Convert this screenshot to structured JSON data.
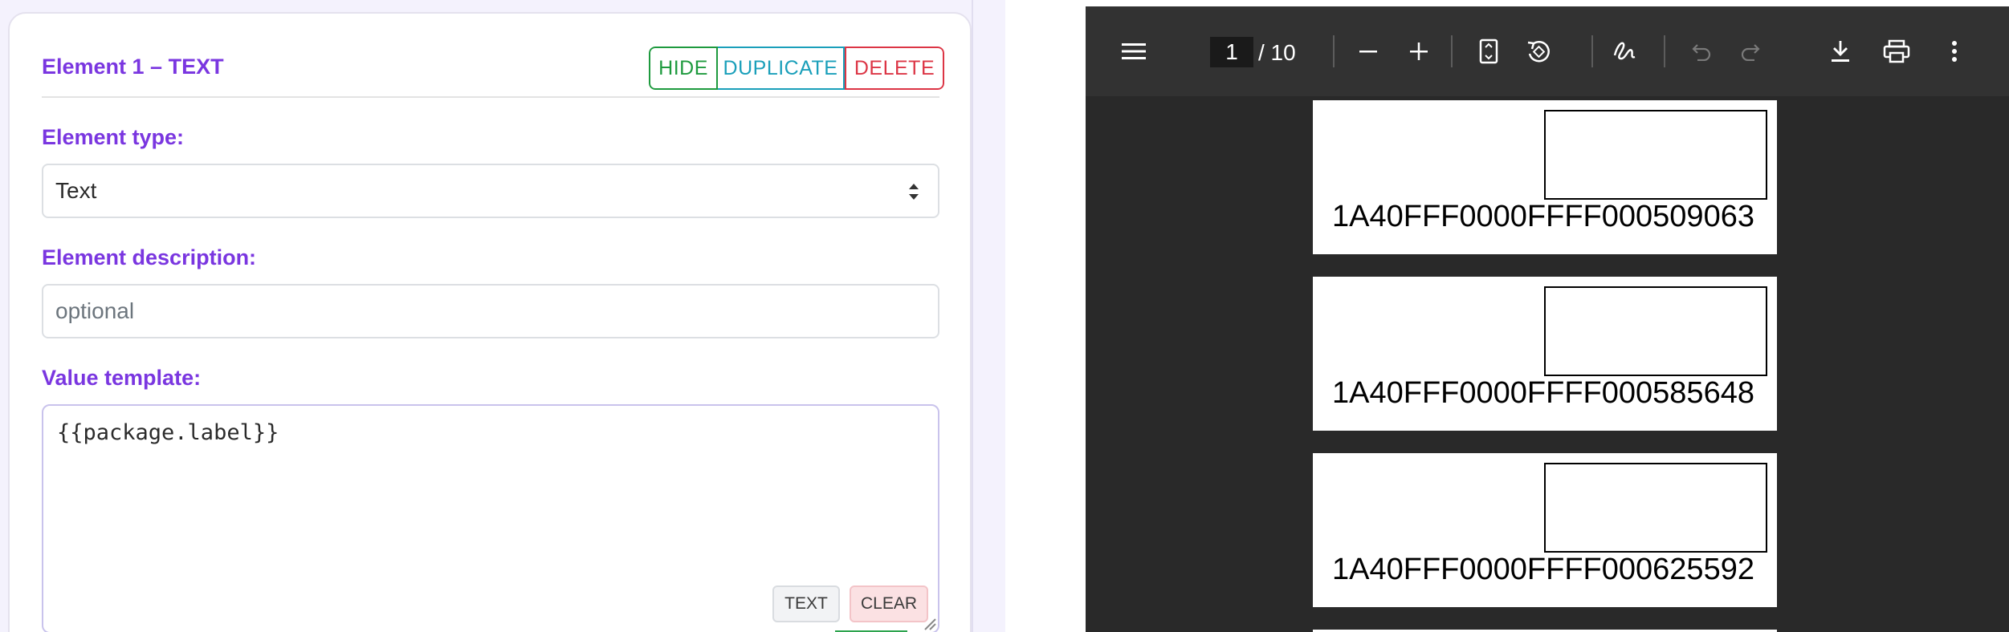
{
  "editor": {
    "card_title": "Element 1 – TEXT",
    "actions": {
      "hide": "HIDE",
      "duplicate": "DUPLICATE",
      "delete": "DELETE"
    },
    "element_type": {
      "label": "Element type:",
      "value": "Text"
    },
    "element_description": {
      "label": "Element description:",
      "placeholder": "optional"
    },
    "value_template": {
      "label": "Value template:",
      "value": "{{package.label}}",
      "text_button": "TEXT",
      "clear_button": "CLEAR"
    }
  },
  "pdf_viewer": {
    "current_page": "1",
    "page_total": "/ 10",
    "toolbar_icons": [
      "menu-icon",
      "zoom-out-icon",
      "zoom-in-icon",
      "fit-page-icon",
      "rotate-icon",
      "annotate-icon",
      "undo-icon",
      "redo-icon",
      "download-icon",
      "print-icon",
      "more-options-icon"
    ],
    "labels": [
      {
        "code": "1A40FFF0000FFFF000509063"
      },
      {
        "code": "1A40FFF0000FFFF000585648"
      },
      {
        "code": "1A40FFF0000FFFF000625592"
      }
    ]
  },
  "colors": {
    "accent_purple": "#7a36e0",
    "hide_green": "#1e9a3e",
    "duplicate_teal": "#1a9fba",
    "delete_red": "#dc3545",
    "viewer_toolbar": "#323232",
    "viewer_background": "#292929"
  }
}
